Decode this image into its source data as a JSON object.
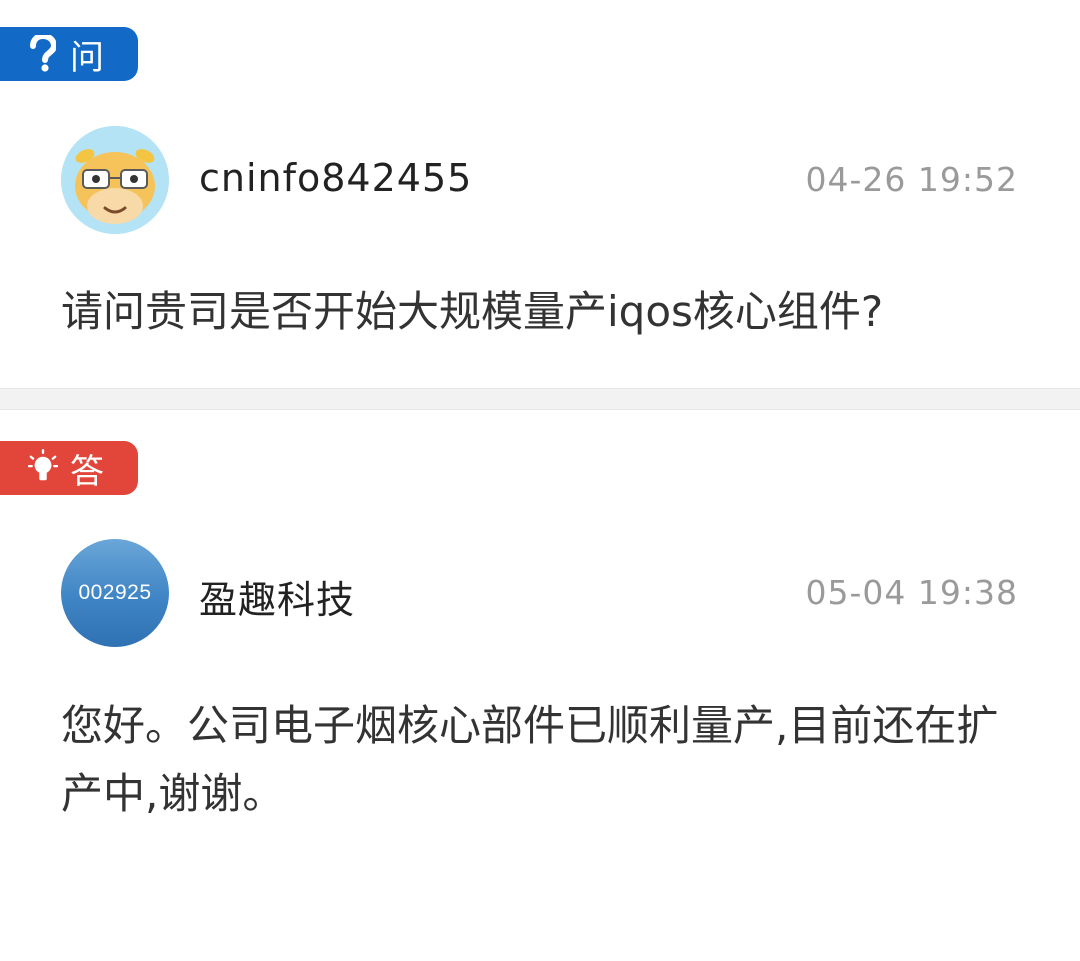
{
  "question": {
    "tag_label": "问",
    "tag_color": "#1269c6",
    "tag_icon": "question-mark-icon",
    "avatar": "cartoon-cow-avatar",
    "username": "cninfo842455",
    "timestamp": "04-26 19:52",
    "text": "请问贵司是否开始大规模量产iqos核心组件?"
  },
  "answer": {
    "tag_label": "答",
    "tag_color": "#e2453a",
    "tag_icon": "lightbulb-icon",
    "avatar_text": "002925",
    "username": "盈趣科技",
    "timestamp": "05-04 19:38",
    "text": "您好。公司电子烟核心部件已顺利量产,目前还在扩产中,谢谢。"
  }
}
